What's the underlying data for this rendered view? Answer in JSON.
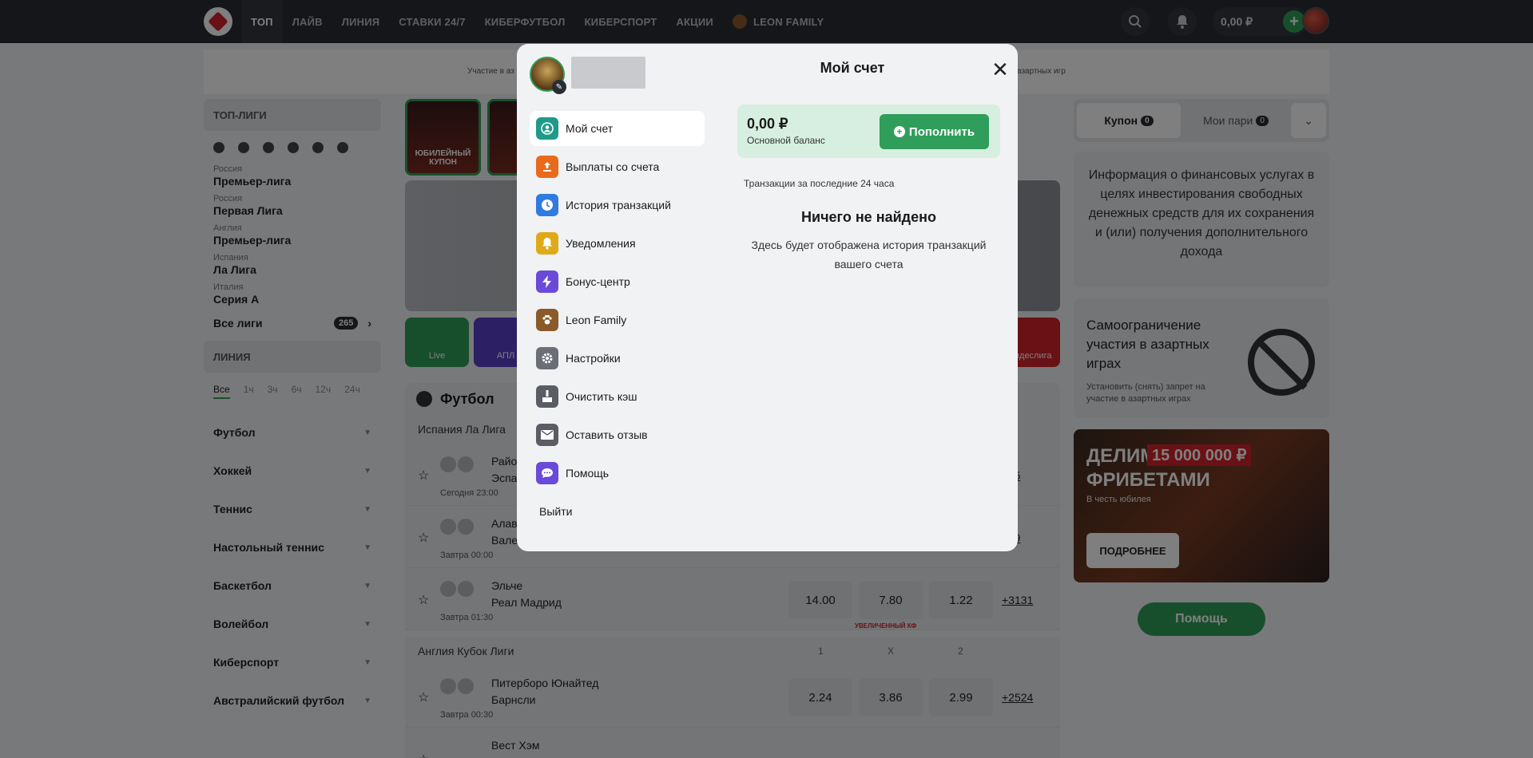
{
  "topnav": {
    "items": [
      "ТОП",
      "ЛАЙВ",
      "ЛИНИЯ",
      "СТАВКИ 24/7",
      "КИБЕРФУТБОЛ",
      "КИБЕРСПОРТ",
      "АКЦИИ",
      "LEON FAMILY"
    ],
    "balance": "0,00 ₽"
  },
  "banner": {
    "text1": "Участие в аз",
    "text2": "азартных игр"
  },
  "left": {
    "top_leagues_title": "ТОП-ЛИГИ",
    "leagues": [
      {
        "country": "Россия",
        "name": "Премьер-лига"
      },
      {
        "country": "Россия",
        "name": "Первая Лига"
      },
      {
        "country": "Англия",
        "name": "Премьер-лига"
      },
      {
        "country": "Испания",
        "name": "Ла Лига"
      },
      {
        "country": "Италия",
        "name": "Серия A"
      }
    ],
    "all_leagues": "Все лиги",
    "all_leagues_count": "265",
    "line_title": "ЛИНИЯ",
    "line_tabs": [
      "Все",
      "1ч",
      "3ч",
      "6ч",
      "12ч",
      "24ч"
    ],
    "sports": [
      "Футбол",
      "Хоккей",
      "Теннис",
      "Настольный теннис",
      "Баскетбол",
      "Волейбол",
      "Киберспорт",
      "Австралийский футбол"
    ]
  },
  "center": {
    "promo1": "ЮБИЛЕЙНЫЙ КУПОН",
    "quick_live": "Live",
    "quick_apl": "АПЛ",
    "quick_bundes": "Бундеслига",
    "sport_title": "Футбол",
    "league1": "Испания Ла Лига",
    "matches": [
      {
        "t1": "Райо",
        "t2": "Эспа",
        "when": "Сегодня 23:00",
        "odds": [
          "",
          "",
          ""
        ],
        "more": "045"
      },
      {
        "t1": "Алав",
        "t2": "Вале",
        "when": "Завтра 00:00",
        "odds": [
          "",
          "",
          ""
        ],
        "more": "719"
      },
      {
        "t1": "Эльче",
        "t2": "Реал Мадрид",
        "when": "Завтра 01:30",
        "odds": [
          "14.00",
          "7.80",
          "1.22"
        ],
        "more": "+3131",
        "boost": "УВЕЛИЧЕННЫЙ КФ"
      }
    ],
    "league2": "Англия Кубок Лиги",
    "league2_cols": [
      "1",
      "X",
      "2"
    ],
    "matches2": [
      {
        "t1": "Питерборо Юнайтед",
        "t2": "Барнсли",
        "when": "Завтра 00:30",
        "odds": [
          "2.24",
          "3.86",
          "2.99"
        ],
        "more": "+2524"
      },
      {
        "t1": "Вест Хэм",
        "t2": "",
        "when": "",
        "odds": [
          "",
          "",
          ""
        ],
        "more": ""
      }
    ]
  },
  "right": {
    "coupon_tab": "Купон",
    "coupon_count": "0",
    "bets_tab": "Мои пари",
    "bets_count": "0",
    "info_text": "Информация о финансовых услугах в целях инвестирования свободных денежных средств для их сохранения и (или) получения дополнительного дохода",
    "self_title": "Самоограничение участия в азартных играх",
    "self_sub": "Установить (снять) запрет на участие в азартных играх",
    "promo_line1": "ДЕЛИМ",
    "promo_num": "15 000 000 ₽",
    "promo_line2": "ФРИБЕТАМИ",
    "promo_sub": "В честь юбилея",
    "promo_btn": "ПОДРОБНЕЕ",
    "help": "Помощь"
  },
  "modal": {
    "title": "Мой счет",
    "menu": [
      {
        "label": "Мой счет",
        "icon": "user-icon",
        "color": "#1f9a8a"
      },
      {
        "label": "Выплаты со счета",
        "icon": "upload-icon",
        "color": "#e86a1a"
      },
      {
        "label": "История транзакций",
        "icon": "clock-icon",
        "color": "#2f7be0"
      },
      {
        "label": "Уведомления",
        "icon": "bell-icon",
        "color": "#e0a91a"
      },
      {
        "label": "Бонус-центр",
        "icon": "bolt-icon",
        "color": "#6a4ad8"
      },
      {
        "label": "Leon Family",
        "icon": "paw-icon",
        "color": "#8a5a2a"
      },
      {
        "label": "Настройки",
        "icon": "gear-icon",
        "color": "#6b6e75"
      },
      {
        "label": "Очистить кэш",
        "icon": "broom-icon",
        "color": "#5a5d63"
      },
      {
        "label": "Оставить отзыв",
        "icon": "mail-icon",
        "color": "#5a5d63"
      },
      {
        "label": "Помощь",
        "icon": "chat-icon",
        "color": "#6a4ad8"
      }
    ],
    "logout": "Выйти",
    "balance_amount": "0,00 ₽",
    "balance_label": "Основной баланс",
    "deposit": "Пополнить",
    "tx_head": "Транзакции за последние 24 часа",
    "empty_title": "Ничего не найдено",
    "empty_sub": "Здесь будет отображена история транзакций вашего счета"
  }
}
